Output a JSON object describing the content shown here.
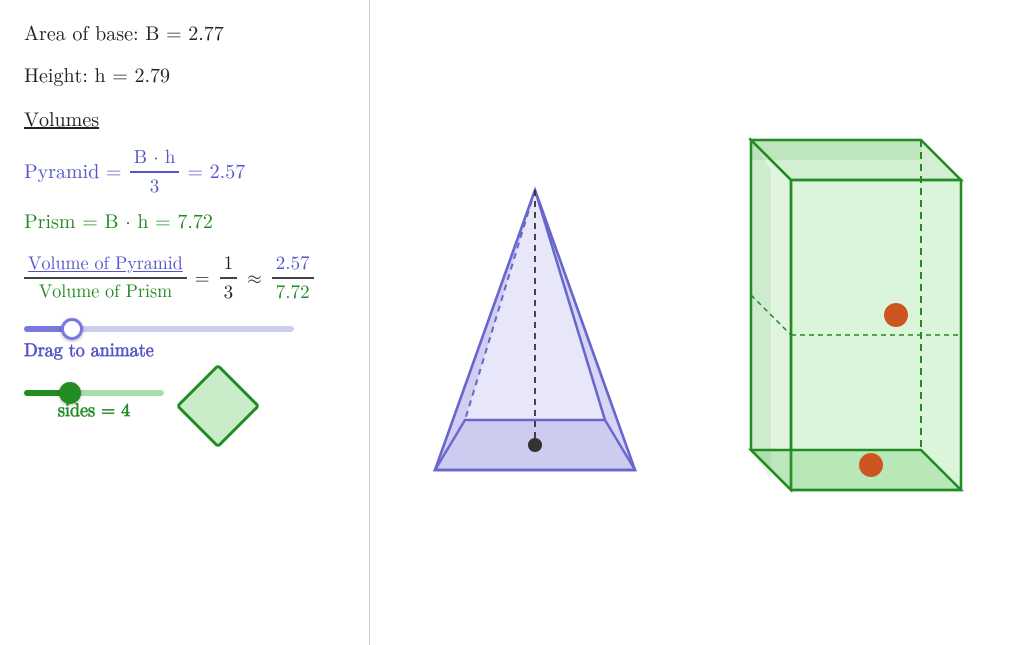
{
  "left": {
    "area_label": "Area of base: B = 2.77",
    "height_label": "Height: h = 2.79",
    "volumes_heading": "Volumes",
    "pyramid_eq_prefix": "Pyramid =",
    "pyramid_num": "B · h",
    "pyramid_den": "3",
    "pyramid_result": "= 2.57",
    "prism_eq": "Prism = B · h = 7.72",
    "ratio_num_label": "Volume of Pyramid",
    "ratio_den_label": "Volume of Prism",
    "ratio_eq1_num": "1",
    "ratio_eq1_den": "3",
    "ratio_approx_num": "2.57",
    "ratio_approx_den": "7.72",
    "drag_label": "Drag to animate",
    "sides_label": "sides = 4",
    "slider_animate_value": 15,
    "slider_sides_value": 30
  }
}
